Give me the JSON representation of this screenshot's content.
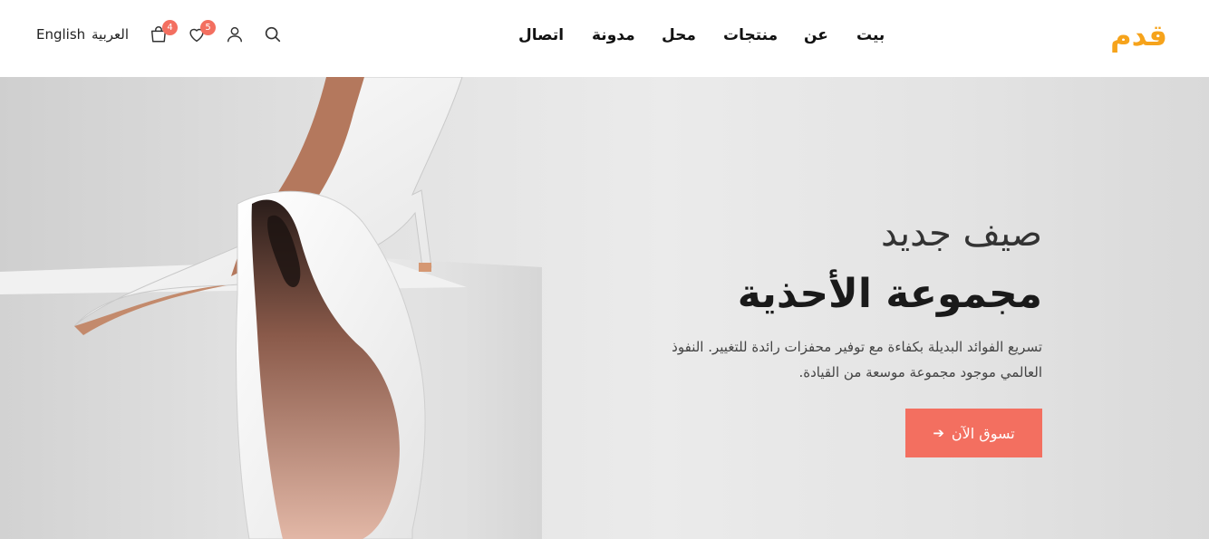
{
  "header": {
    "logo": "قدم",
    "languages": {
      "english": "English",
      "arabic": "العربية"
    },
    "nav": {
      "home": "بيت",
      "about": "عن",
      "products": "منتجات",
      "shop": "محل",
      "blog": "مدونة",
      "contact": "اتصال"
    },
    "cart_count": "4",
    "wishlist_count": "5",
    "icons": [
      "search-icon",
      "user-icon",
      "heart-icon",
      "shopping-bag-icon"
    ]
  },
  "hero": {
    "subtitle": "صيف جديد",
    "title": "مجموعة الأحذية",
    "description": "تسريع الفوائد البديلة بكفاءة مع توفير محفزات رائدة للتغيير. النفوذ العالمي موجود مجموعة موسعة من القيادة.",
    "cta_label": "تسوق الآن",
    "cta_icon": "arrow-right-icon"
  },
  "colors": {
    "logo": "#f6a31b",
    "accent": "#f36f60",
    "badge": "#f36f60"
  }
}
